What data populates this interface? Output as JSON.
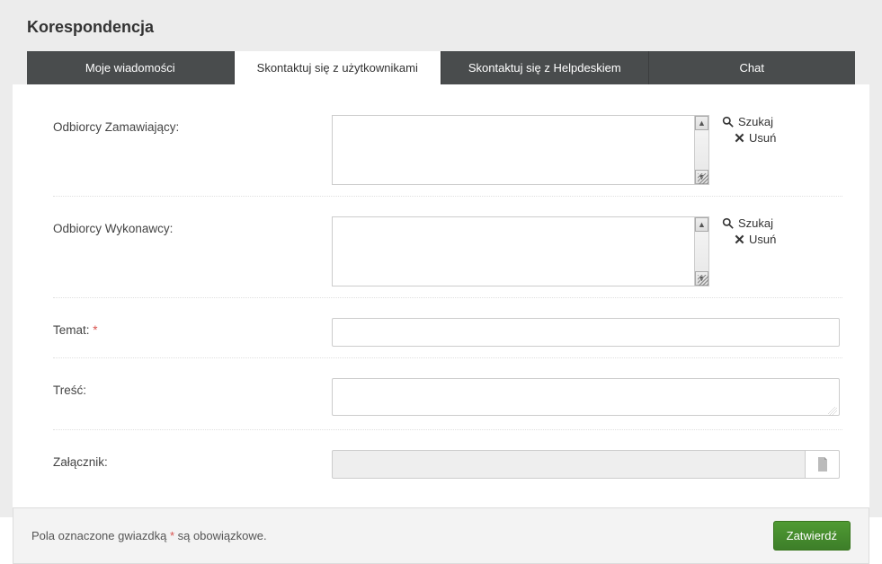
{
  "title": "Korespondencja",
  "tabs": {
    "my_messages": "Moje wiadomości",
    "contact_users": "Skontaktuj się z użytkownikami",
    "contact_helpdesk": "Skontaktuj się z Helpdeskiem",
    "chat": "Chat"
  },
  "form": {
    "recipients_orderers_label": "Odbiorcy Zamawiający:",
    "recipients_contractors_label": "Odbiorcy Wykonawcy:",
    "subject_label": "Temat:",
    "content_label": "Treść:",
    "attachment_label": "Załącznik:",
    "recipients_orderers_value": "",
    "recipients_contractors_value": "",
    "subject_value": "",
    "content_value": "",
    "attachment_value": ""
  },
  "actions": {
    "search": "Szukaj",
    "remove": "Usuń",
    "submit": "Zatwierdź"
  },
  "footer": {
    "required_note_prefix": "Pola oznaczone gwiazdką ",
    "required_note_suffix": " są obowiązkowe."
  }
}
